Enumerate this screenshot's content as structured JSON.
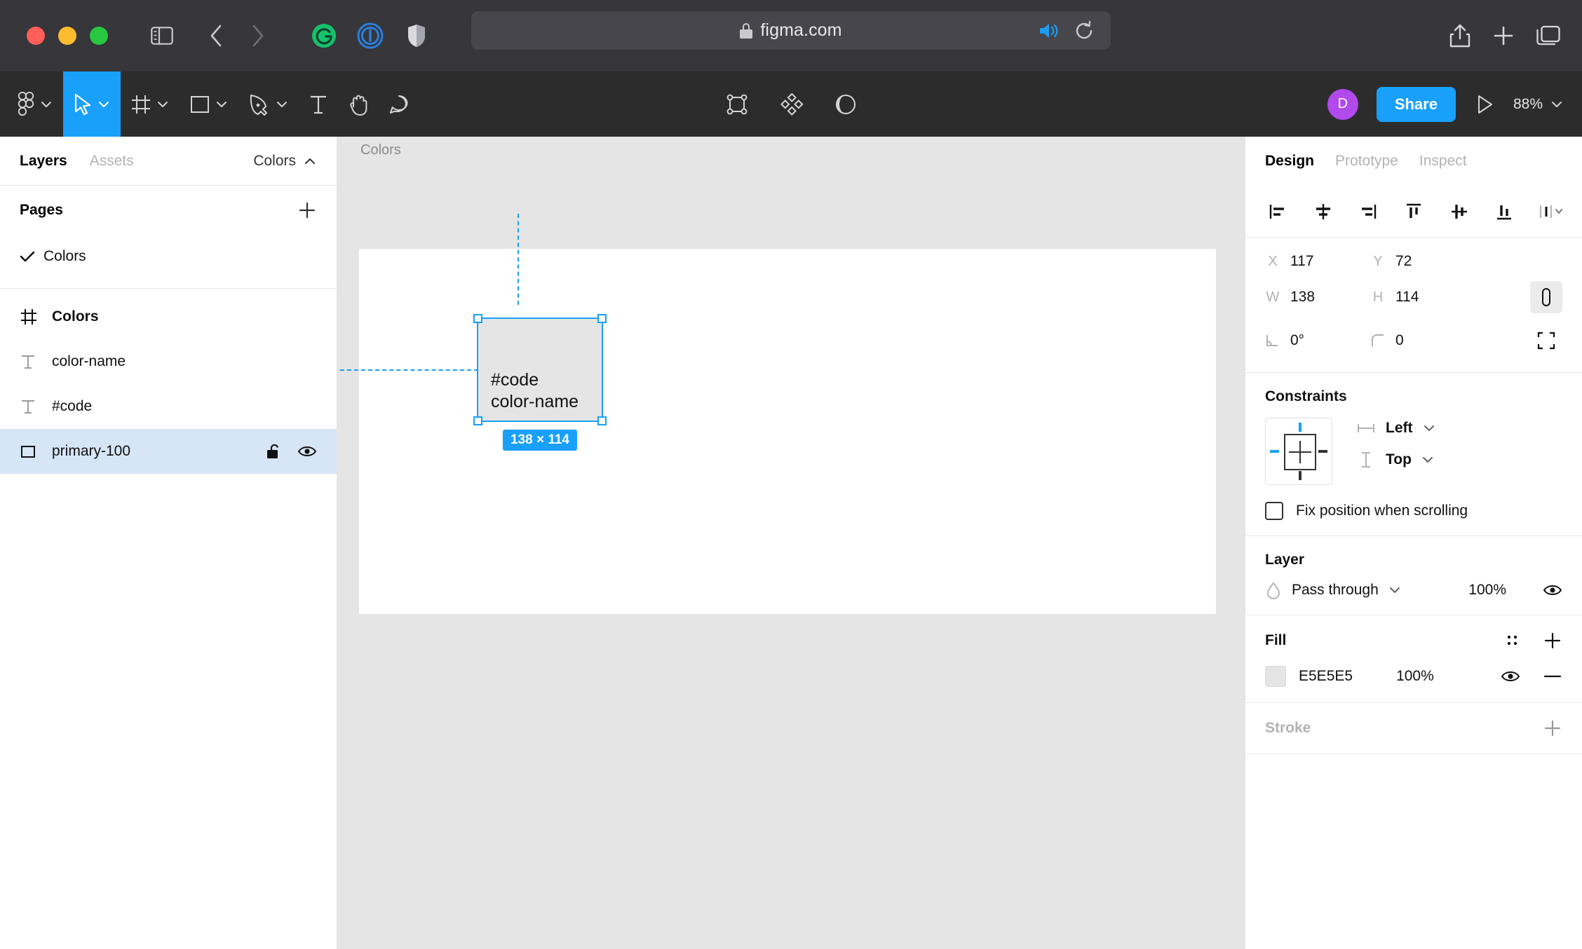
{
  "browser": {
    "url": "figma.com",
    "lock_icon": "lock-icon",
    "traffic_lights": [
      "close",
      "minimize",
      "maximize"
    ],
    "extensions": [
      "grammarly-icon",
      "onepassword-icon",
      "shield-icon"
    ],
    "nav": [
      "back-arrow-icon",
      "forward-arrow-icon"
    ],
    "url_right_icons": [
      "audio-icon",
      "reload-icon"
    ],
    "right_icons": [
      "share-icon",
      "new-tab-icon",
      "tabs-overview-icon"
    ]
  },
  "toolbar": {
    "menu_icon": "figma-logo-icon",
    "tools": [
      {
        "name": "move",
        "icon": "cursor-icon",
        "active": true,
        "has_dropdown": true
      },
      {
        "name": "frame",
        "icon": "frame-icon",
        "active": false,
        "has_dropdown": true
      },
      {
        "name": "shape",
        "icon": "rectangle-icon",
        "active": false,
        "has_dropdown": true
      },
      {
        "name": "pen",
        "icon": "pen-icon",
        "active": false,
        "has_dropdown": true
      },
      {
        "name": "text",
        "icon": "text-icon",
        "active": false,
        "has_dropdown": false
      },
      {
        "name": "hand",
        "icon": "hand-icon",
        "active": false,
        "has_dropdown": false
      },
      {
        "name": "comment",
        "icon": "comment-icon",
        "active": false,
        "has_dropdown": false
      }
    ],
    "center_icons": [
      "create-component-icon",
      "component-instance-icon",
      "mask-icon"
    ],
    "avatar_initial": "D",
    "share_label": "Share",
    "present_icon": "play-icon",
    "zoom_level": "88%"
  },
  "left_panel": {
    "tabs": [
      {
        "label": "Layers",
        "active": true
      },
      {
        "label": "Assets",
        "active": false
      }
    ],
    "file_name": "Colors",
    "pages": {
      "title": "Pages",
      "add_label": "+",
      "items": [
        {
          "label": "Colors",
          "selected": true
        }
      ]
    },
    "layers": [
      {
        "label": "Colors",
        "icon": "frame-icon",
        "type": "frame",
        "selected": false
      },
      {
        "label": "color-name",
        "icon": "text-layer-icon",
        "type": "text",
        "selected": false
      },
      {
        "label": "#code",
        "icon": "text-layer-icon",
        "type": "text",
        "selected": false
      },
      {
        "label": "primary-100",
        "icon": "rectangle-layer-icon",
        "type": "rectangle",
        "selected": true,
        "lock_icon": "unlock-icon",
        "visibility_icon": "eye-icon"
      }
    ]
  },
  "canvas": {
    "frame_label": "Colors",
    "selection": {
      "text_line1": "#code",
      "text_line2": "color-name",
      "size_badge": "138 × 114",
      "fill_color": "#E5E5E5",
      "selection_color": "#18A0FB"
    }
  },
  "right_panel": {
    "tabs": [
      {
        "label": "Design",
        "active": true
      },
      {
        "label": "Prototype",
        "active": false
      },
      {
        "label": "Inspect",
        "active": false
      }
    ],
    "align_icons": [
      "align-left-icon",
      "align-horizontal-center-icon",
      "align-right-icon",
      "align-top-icon",
      "align-vertical-center-icon",
      "align-bottom-icon",
      "distribute-icon"
    ],
    "properties": {
      "x_key": "X",
      "x_value": "117",
      "y_key": "Y",
      "y_value": "72",
      "w_key": "W",
      "w_value": "138",
      "h_key": "H",
      "h_value": "114",
      "rotation_value": "0°",
      "corner_radius_value": "0",
      "link_icon": "link-ratio-icon",
      "independent_corners_icon": "independent-corners-icon"
    },
    "constraints": {
      "title": "Constraints",
      "horizontal": "Left",
      "vertical": "Top",
      "horizontal_icon": "horizontal-constraint-icon",
      "vertical_icon": "vertical-constraint-icon",
      "fix_position_label": "Fix position when scrolling",
      "fix_position_checked": false
    },
    "layer": {
      "title": "Layer",
      "blend_mode": "Pass through",
      "opacity": "100%",
      "blend_icon": "blend-mode-icon",
      "visibility_icon": "eye-icon"
    },
    "fill": {
      "title": "Fill",
      "styles_icon": "styles-icon",
      "add_icon": "plus-icon",
      "hex": "E5E5E5",
      "opacity": "100%",
      "visibility_icon": "eye-icon",
      "remove_icon": "minus-icon"
    },
    "stroke": {
      "title": "Stroke",
      "add_icon": "plus-icon"
    }
  }
}
